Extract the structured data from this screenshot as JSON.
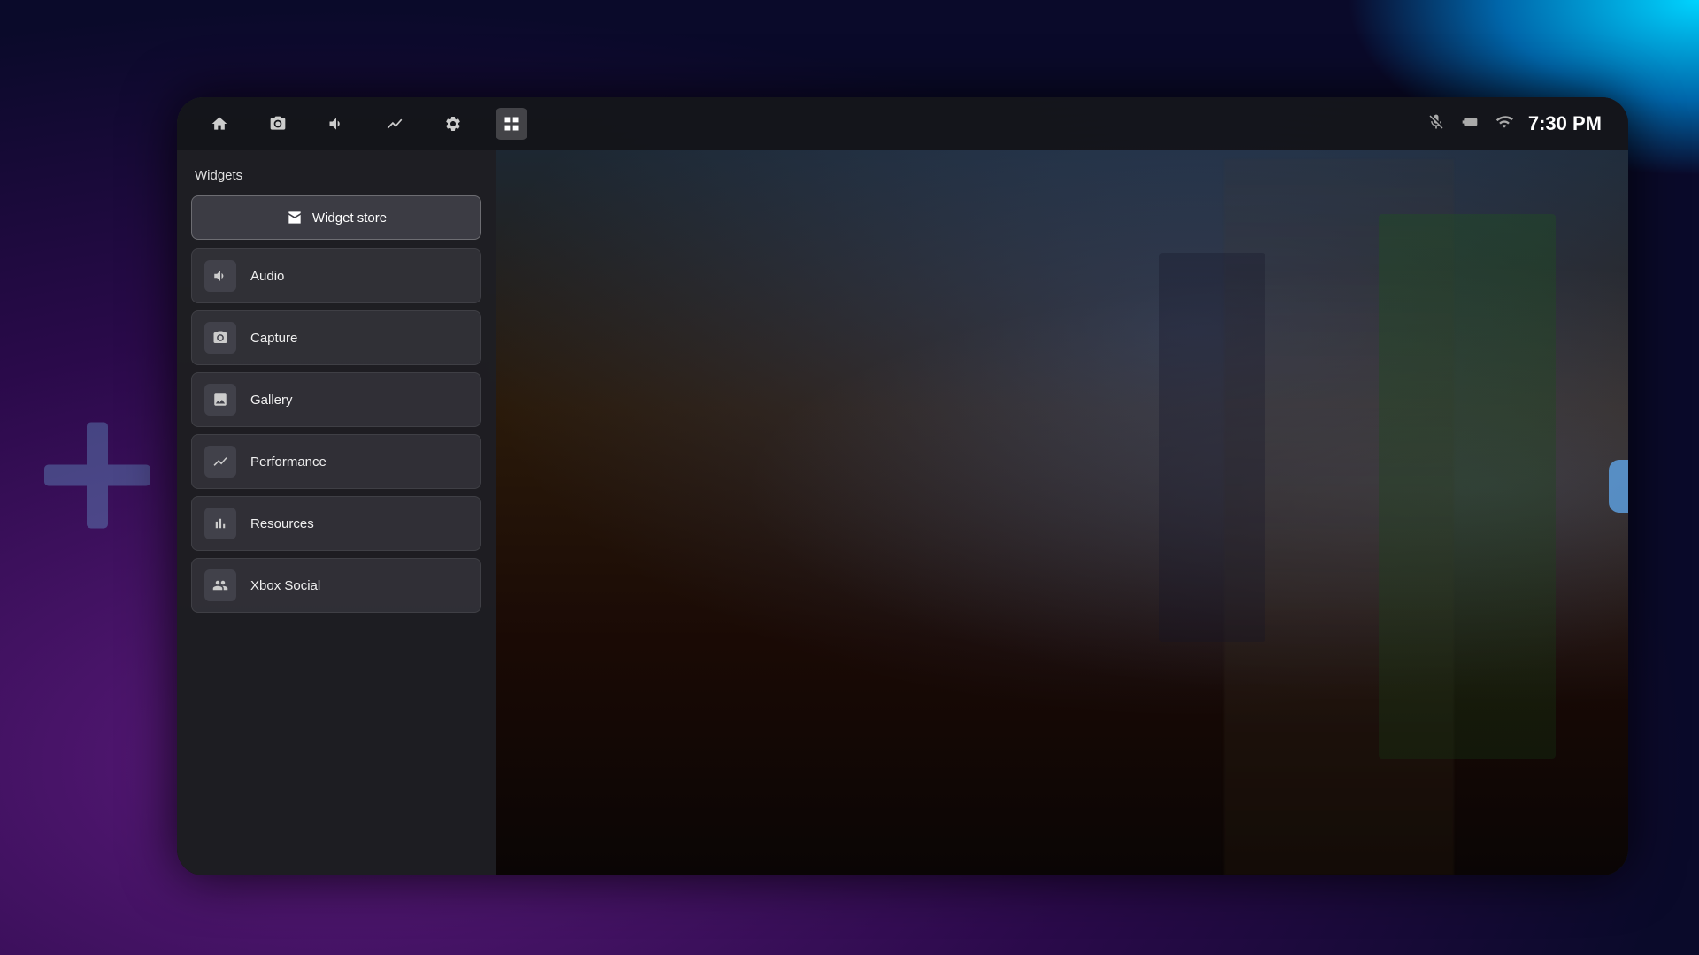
{
  "background": {
    "topRightAccent": "#00d4ff",
    "baseColor": "#1a0a2e"
  },
  "topbar": {
    "nav_icons": [
      {
        "id": "home",
        "label": "Home",
        "active": false
      },
      {
        "id": "camera",
        "label": "Camera",
        "active": false
      },
      {
        "id": "audio",
        "label": "Audio",
        "active": false
      },
      {
        "id": "performance",
        "label": "Performance",
        "active": false
      },
      {
        "id": "settings",
        "label": "Settings",
        "active": false
      },
      {
        "id": "widgets",
        "label": "Widgets",
        "active": true
      }
    ],
    "status": {
      "mic_muted": true,
      "battery": "battery",
      "wifi": "wifi",
      "time": "7:30 PM"
    }
  },
  "widget_panel": {
    "title": "Widgets",
    "store_button": {
      "label": "Widget store",
      "icon": "store"
    },
    "items": [
      {
        "id": "audio",
        "label": "Audio",
        "icon": "audio"
      },
      {
        "id": "capture",
        "label": "Capture",
        "icon": "capture"
      },
      {
        "id": "gallery",
        "label": "Gallery",
        "icon": "gallery"
      },
      {
        "id": "performance",
        "label": "Performance",
        "icon": "performance"
      },
      {
        "id": "resources",
        "label": "Resources",
        "icon": "resources"
      },
      {
        "id": "xbox-social",
        "label": "Xbox Social",
        "icon": "xbox-social"
      }
    ]
  }
}
